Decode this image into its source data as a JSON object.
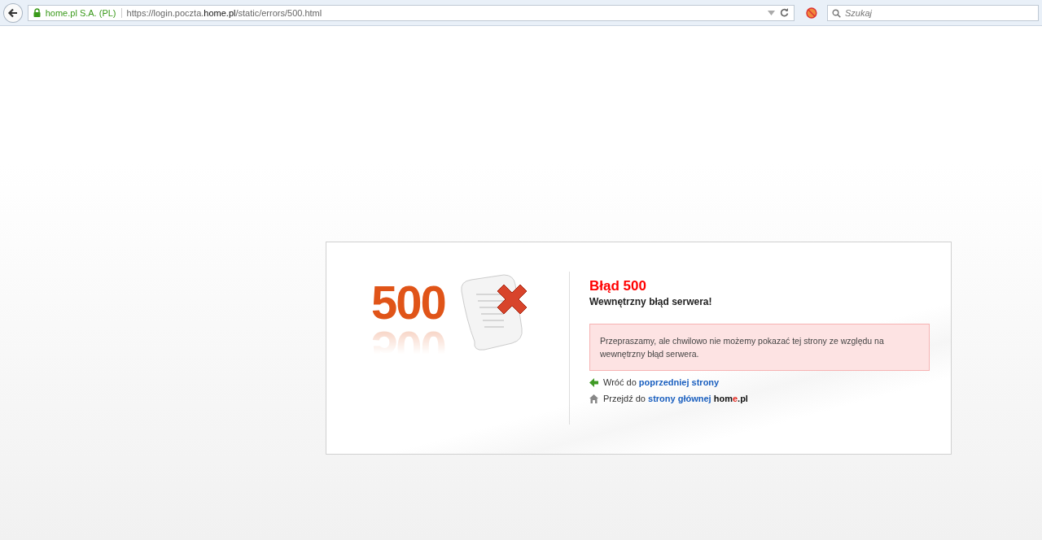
{
  "browser": {
    "site_identity": "home.pl S.A. (PL)",
    "url": "https://login.poczta.**home.pl**/static/errors/500.html",
    "search": {
      "placeholder": "Szukaj"
    }
  },
  "error": {
    "code_graphic": "500",
    "title": "Błąd 500",
    "subtitle": "Wewnętrzny błąd serwera!",
    "message": "Przepraszamy, ale chwilowo nie możemy pokazać tej strony ze względu na wewnętrzny błąd serwera.",
    "links": [
      {
        "kind": "back",
        "prefix": "Wróć do",
        "link": "poprzedniej strony"
      },
      {
        "kind": "home",
        "prefix": "Przejdź do",
        "link": "strony głównej",
        "brand": [
          {
            "text": "hom",
            "color": "#111111"
          },
          {
            "text": "e",
            "color": "#e3241b"
          },
          {
            "text": ".pl",
            "color": "#111111"
          }
        ]
      }
    ]
  }
}
